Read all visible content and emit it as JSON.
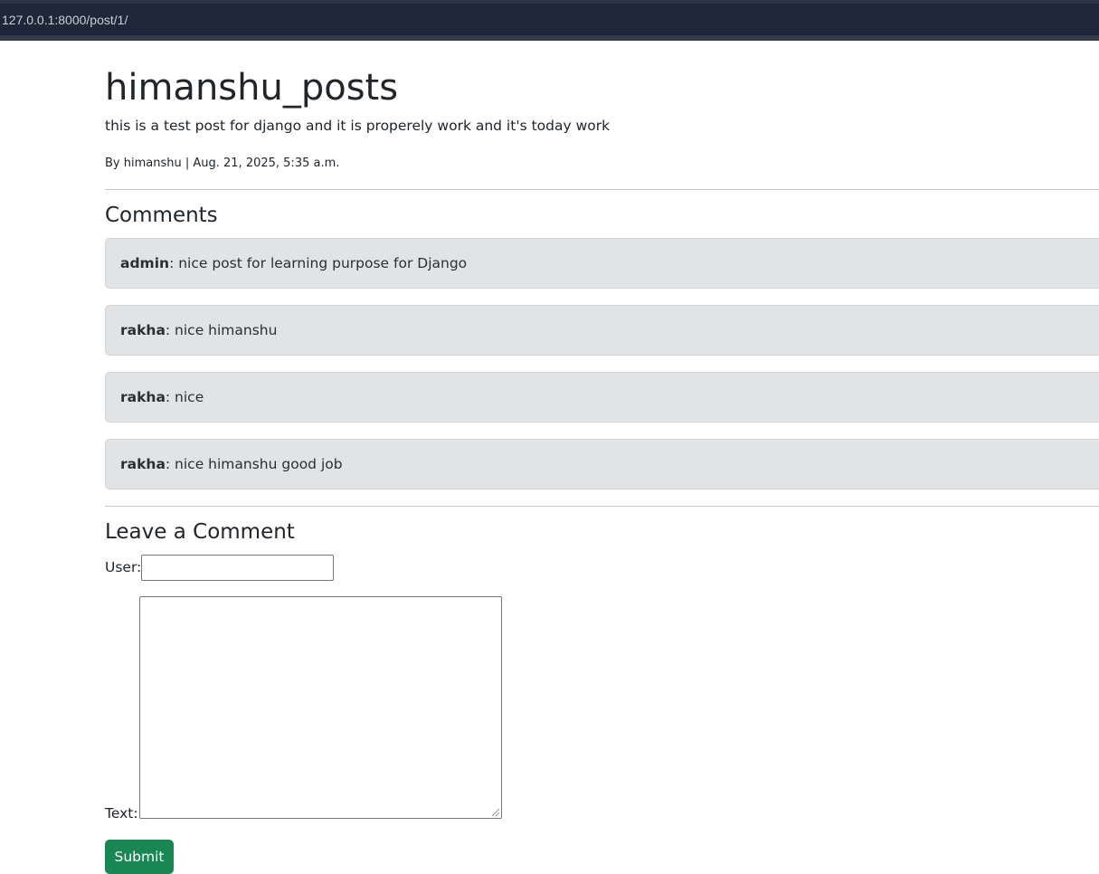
{
  "browser": {
    "url": "127.0.0.1:8000/post/1/"
  },
  "post": {
    "title": "himanshu_posts",
    "body": "this is a test post for django and it is properely work and it's today work",
    "meta": "By himanshu | Aug. 21, 2025, 5:35 a.m."
  },
  "comments": {
    "heading": "Comments",
    "items": [
      {
        "author": "admin",
        "text": ": nice post for learning purpose for Django"
      },
      {
        "author": "rakha",
        "text": ": nice himanshu"
      },
      {
        "author": "rakha",
        "text": ": nice"
      },
      {
        "author": "rakha",
        "text": ": nice himanshu good job"
      }
    ]
  },
  "form": {
    "heading": "Leave a Comment",
    "user_label": "User:",
    "user_value": "",
    "text_label": "Text:",
    "text_value": "",
    "submit_label": "Submit"
  },
  "colors": {
    "browser_bar": "#1e2638",
    "comment_bg": "#e2e3e5",
    "submit_bg": "#198754"
  }
}
